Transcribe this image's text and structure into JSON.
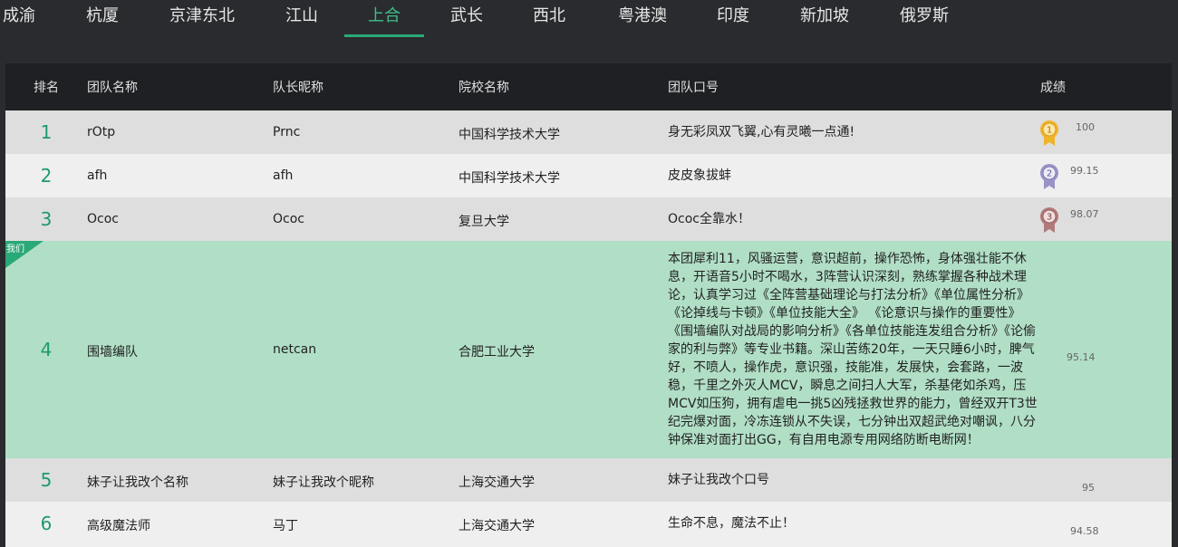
{
  "tabs": [
    "成渝",
    "杭厦",
    "京津东北",
    "江山",
    "上合",
    "武长",
    "西北",
    "粤港澳",
    "印度",
    "新加坡",
    "俄罗斯"
  ],
  "active_tab": "上合",
  "header": {
    "rank": "排名",
    "team": "团队名称",
    "captain": "队长昵称",
    "school": "院校名称",
    "slogan": "团队口号",
    "score": "成绩"
  },
  "us_label": "我们",
  "colors": {
    "accent": "#2aa978",
    "gold": "#f0b429",
    "silver": "#9a93c8",
    "bronze": "#b07a7a"
  },
  "rows": [
    {
      "rank": "1",
      "team": "rOtp",
      "captain": "Prnc",
      "school": "中国科学技术大学",
      "slogan": "身无彩凤双飞翼,心有灵曦一点通!",
      "score": "100",
      "medal": "1"
    },
    {
      "rank": "2",
      "team": "afh",
      "captain": "afh",
      "school": "中国科学技术大学",
      "slogan": "皮皮象拔蚌",
      "score": "99.15",
      "medal": "2"
    },
    {
      "rank": "3",
      "team": "Ococ",
      "captain": "Ococ",
      "school": "复旦大学",
      "slogan": "Ococ全靠水！",
      "score": "98.07",
      "medal": "3"
    },
    {
      "rank": "4",
      "team": "围墙编队",
      "captain": "netcan",
      "school": "合肥工业大学",
      "slogan": "本团犀利11，风骚运营，意识超前，操作恐怖，身体强壮能不休息，开语音5小时不喝水，3阵营认识深刻，熟练掌握各种战术理论，认真学习过《全阵营基础理论与打法分析》《单位属性分析》《论掉线与卡顿》《单位技能大全》 《论意识与操作的重要性》《围墙编队对战局的影响分析》《各单位技能连发组合分析》《论偷家的利与弊》等专业书籍。深山苦练20年，一天只睡6小时，脾气好，不喷人，操作虎，意识强，技能准，发展快，会套路，一波稳，千里之外灭人MCV，瞬息之间扫人大军，杀基佬如杀鸡，压MCV如压狗，拥有虐电一挑5凶残拯救世界的能力，曾经双开T3世纪完爆对面，冷冻连锁从不失误，七分钟出双超武绝对嘲讽，八分钟保准对面打出GG，有自用电源专用网络防断电断网！",
      "score": "95.14",
      "medal": ""
    },
    {
      "rank": "5",
      "team": "妹子让我改个名称",
      "captain": "妹子让我改个昵称",
      "school": "上海交通大学",
      "slogan": "妹子让我改个口号",
      "score": "95",
      "medal": ""
    },
    {
      "rank": "6",
      "team": "高级魔法师",
      "captain": "马丁",
      "school": "上海交通大学",
      "slogan": "生命不息，魔法不止！",
      "score": "94.58",
      "medal": ""
    }
  ]
}
